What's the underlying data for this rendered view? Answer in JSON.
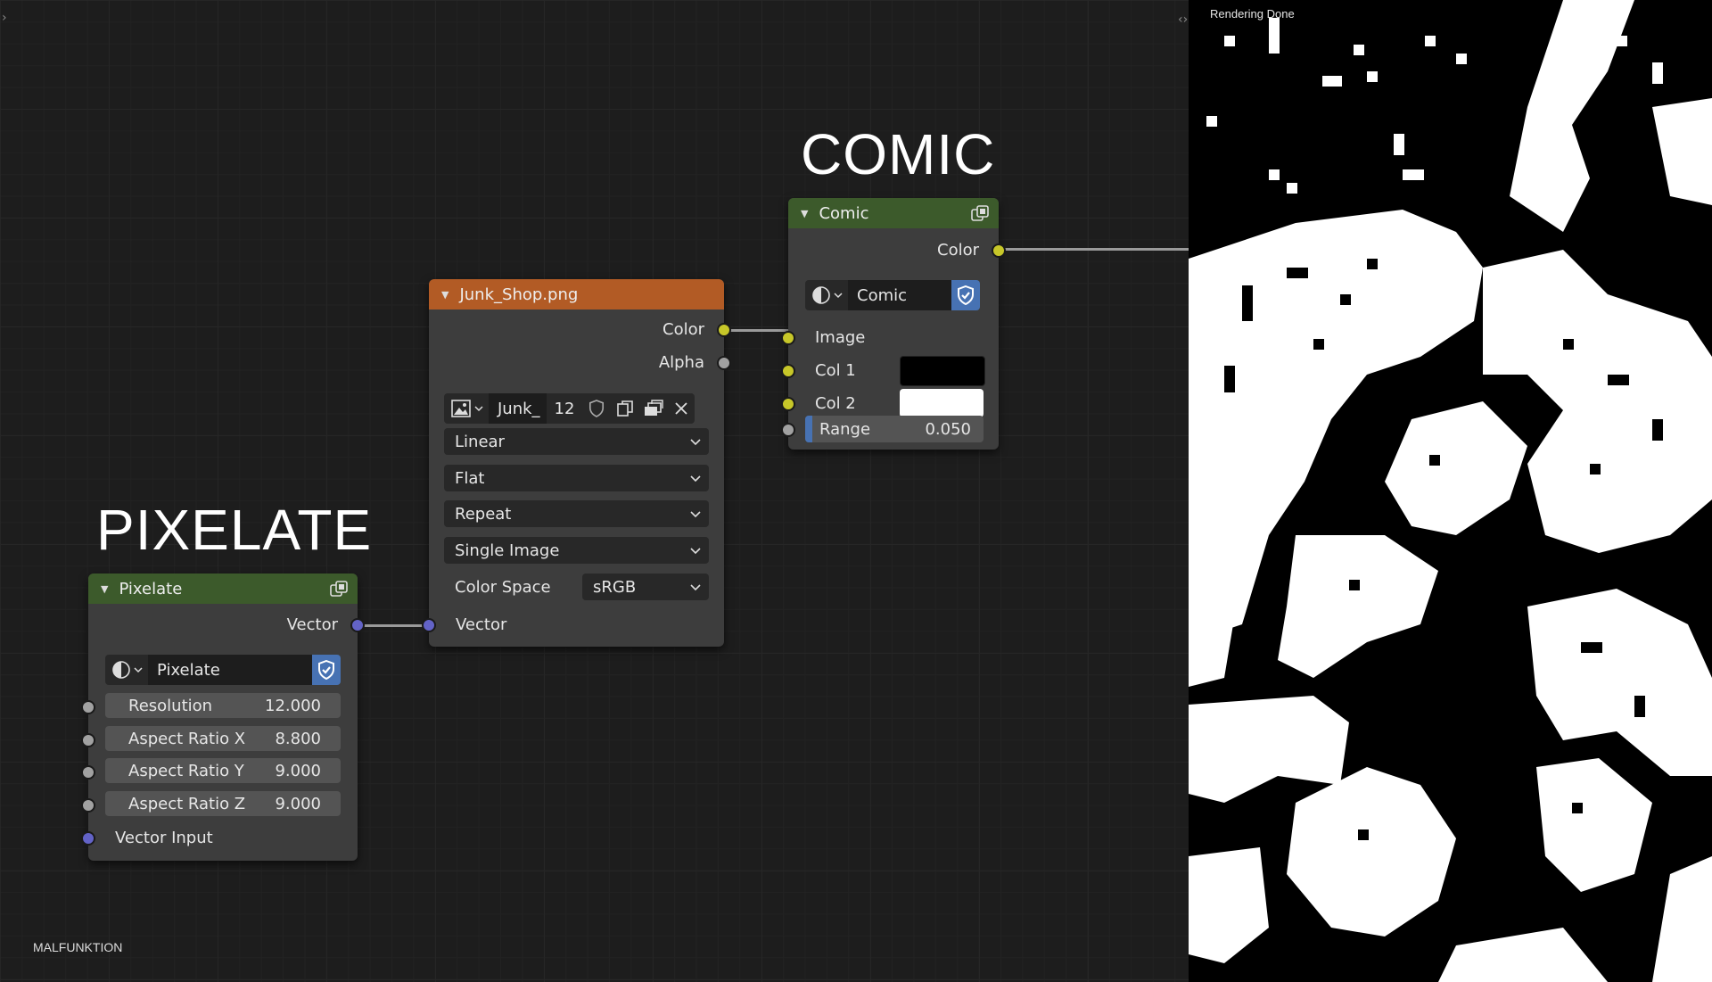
{
  "editor": {
    "watermark": "MALFUNKTION",
    "frames": {
      "comic": "COMIC",
      "pixelate": "PIXELATE"
    }
  },
  "render": {
    "status": "Rendering Done"
  },
  "nodes": {
    "comic": {
      "title": "Comic",
      "output": "Color",
      "nodegroup_name": "Comic",
      "inputs": {
        "image": "Image",
        "col1": "Col 1",
        "col2": "Col 2",
        "range_label": "Range",
        "range_value": "0.050"
      },
      "col1_color": "#000000",
      "col2_color": "#ffffff"
    },
    "image": {
      "title": "Junk_Shop.png",
      "outputs": {
        "color": "Color",
        "alpha": "Alpha"
      },
      "datablock": {
        "name": "Junk_",
        "users": "12"
      },
      "interpolation": "Linear",
      "projection": "Flat",
      "extension": "Repeat",
      "source": "Single Image",
      "colorspace_label": "Color Space",
      "colorspace_value": "sRGB",
      "vector_input": "Vector"
    },
    "pixelate": {
      "title": "Pixelate",
      "output": "Vector",
      "nodegroup_name": "Pixelate",
      "fields": [
        {
          "label": "Resolution",
          "value": "12.000"
        },
        {
          "label": "Aspect Ratio X",
          "value": "8.800"
        },
        {
          "label": "Aspect Ratio Y",
          "value": "9.000"
        },
        {
          "label": "Aspect Ratio Z",
          "value": "9.000"
        }
      ],
      "vector_input": "Vector Input"
    }
  },
  "colors": {
    "header_green": "#3c5a2b",
    "header_orange": "#b25b25",
    "socket_yellow": "#c7c729",
    "socket_gray": "#a1a1a1",
    "socket_blue": "#6363c7",
    "accent_blue": "#4772b3"
  }
}
